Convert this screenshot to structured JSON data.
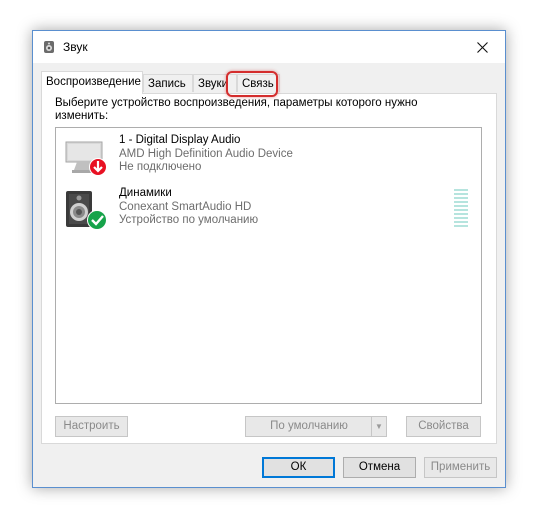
{
  "window": {
    "title": "Звук",
    "icon": "speaker-icon"
  },
  "tabs": [
    {
      "label": "Воспроизведение",
      "active": true
    },
    {
      "label": "Запись",
      "active": false
    },
    {
      "label": "Звуки",
      "active": false
    },
    {
      "label": "Связь",
      "active": false,
      "highlighted": true
    }
  ],
  "instruction": "Выберите устройство воспроизведения, параметры которого нужно изменить:",
  "devices": [
    {
      "name": "1 - Digital Display Audio",
      "driver": "AMD High Definition Audio Device",
      "status": "Не подключено",
      "icon": "monitor-icon",
      "badge": "disconnected-arrow-icon"
    },
    {
      "name": "Динамики",
      "driver": "Conexant SmartAudio HD",
      "status": "Устройство по умолчанию",
      "icon": "speaker-device-icon",
      "badge": "default-check-icon",
      "level": 0
    }
  ],
  "buttons": {
    "configure": "Настроить",
    "set_default": "По умолчанию",
    "properties": "Свойства",
    "ok": "ОК",
    "cancel": "Отмена",
    "apply": "Применить"
  },
  "colors": {
    "accent": "#0078d7",
    "highlight": "#d42d2d",
    "badge_red": "#e81123",
    "badge_green": "#16a34a"
  }
}
